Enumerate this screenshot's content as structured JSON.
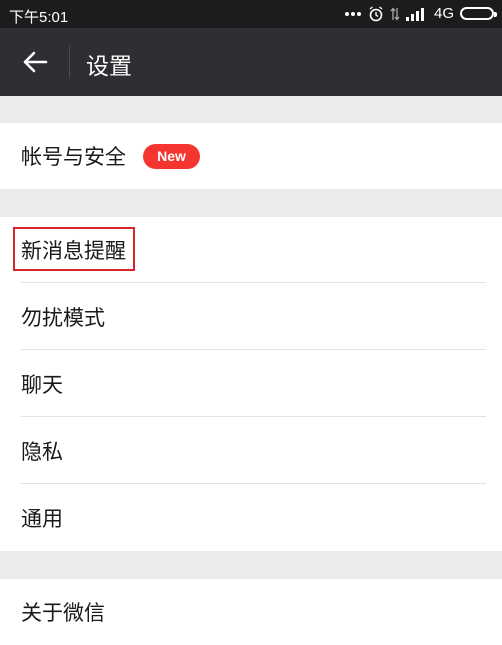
{
  "status_bar": {
    "time": "下午5:01",
    "network": "4G",
    "icons": [
      "more-dots-icon",
      "alarm-icon",
      "data-transfer-icon",
      "signal-icon",
      "battery-icon"
    ]
  },
  "header": {
    "title": "设置",
    "back_icon": "arrow-left-icon"
  },
  "settings": {
    "group1": [
      {
        "label": "帐号与安全",
        "badge": "New"
      }
    ],
    "group2": [
      {
        "label": "新消息提醒",
        "highlighted": true
      },
      {
        "label": "勿扰模式"
      },
      {
        "label": "聊天"
      },
      {
        "label": "隐私"
      },
      {
        "label": "通用"
      }
    ],
    "group3": [
      {
        "label": "关于微信"
      }
    ]
  },
  "colors": {
    "title_bar": "#2e2f33",
    "status_bar": "#1c1c1e",
    "badge": "#f43530",
    "highlight_outline": "#d8262f",
    "section_gap": "#ebebeb"
  }
}
